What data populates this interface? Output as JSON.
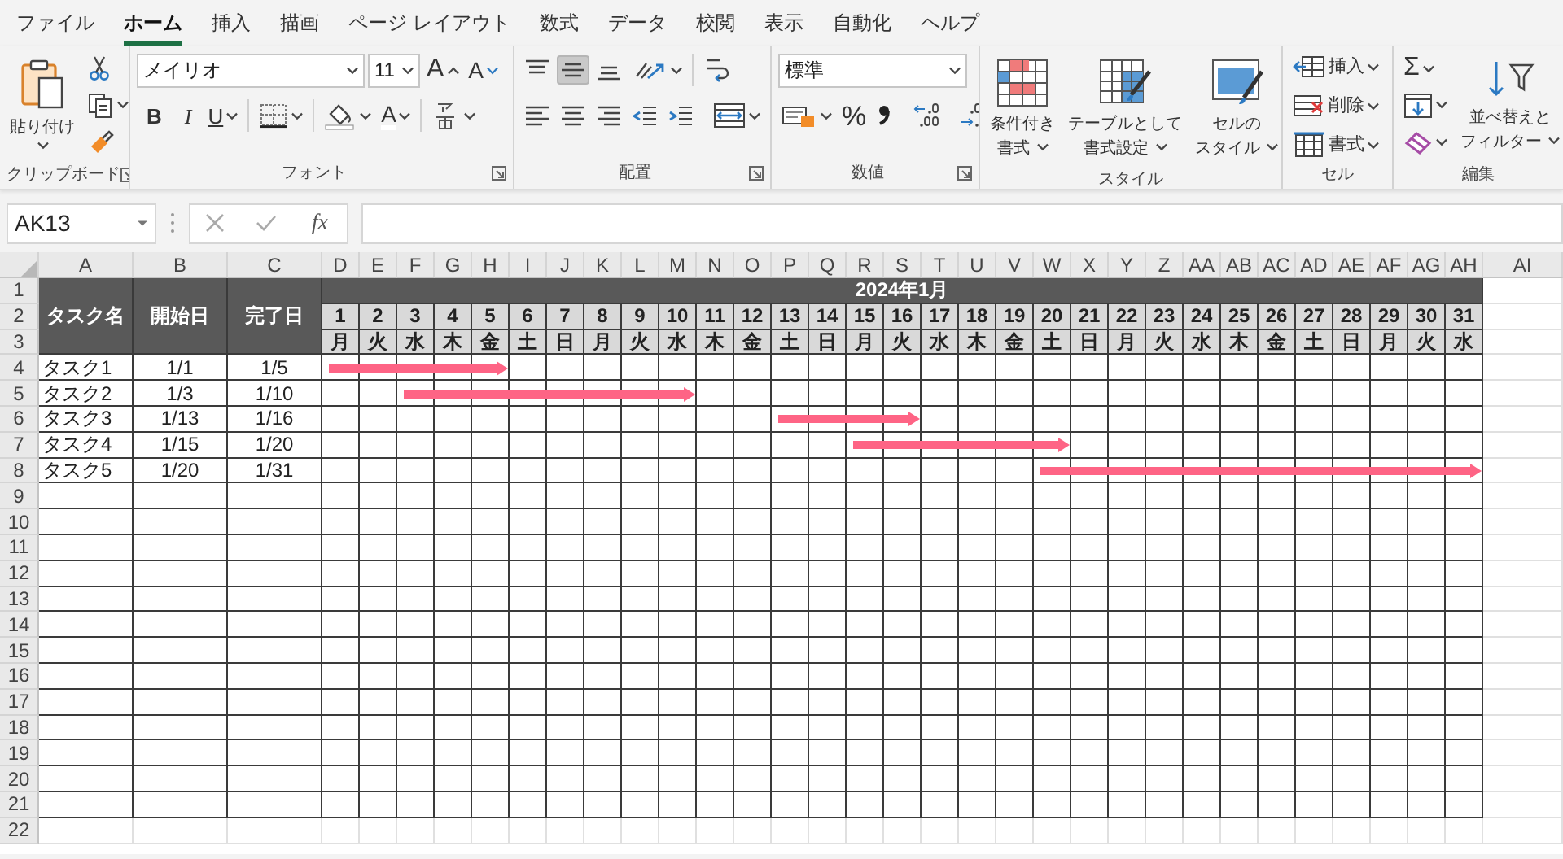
{
  "menu_tabs": [
    {
      "label": "ファイル",
      "selected": false
    },
    {
      "label": "ホーム",
      "selected": true
    },
    {
      "label": "挿入",
      "selected": false
    },
    {
      "label": "描画",
      "selected": false
    },
    {
      "label": "ページ レイアウト",
      "selected": false
    },
    {
      "label": "数式",
      "selected": false
    },
    {
      "label": "データ",
      "selected": false
    },
    {
      "label": "校閲",
      "selected": false
    },
    {
      "label": "表示",
      "selected": false
    },
    {
      "label": "自動化",
      "selected": false
    },
    {
      "label": "ヘルプ",
      "selected": false
    }
  ],
  "ribbon": {
    "clipboard": {
      "paste": "貼り付け",
      "label": "クリップボード"
    },
    "font": {
      "font_name": "メイリオ",
      "font_size": "11",
      "grow": "A",
      "shrink": "A",
      "bold": "B",
      "italic": "I",
      "underline": "U",
      "font_color": "A",
      "label": "フォント"
    },
    "alignment": {
      "vertical_align": [
        {
          "selected": false
        },
        {
          "selected": true
        },
        {
          "selected": false
        }
      ],
      "label": "配置"
    },
    "number": {
      "format": "標準",
      "percent": "%",
      "label": "数値"
    },
    "styles": {
      "buttons": [
        {
          "line1": "条件付き",
          "line2": "書式"
        },
        {
          "line1": "テーブルとして",
          "line2": "書式設定"
        },
        {
          "line1": "セルの",
          "line2": "スタイル"
        }
      ],
      "label": "スタイル"
    },
    "cells": {
      "buttons": [
        "挿入",
        "削除",
        "書式"
      ],
      "label": "セル"
    },
    "editing": {
      "autosum": "Σ",
      "sort_filter": {
        "line1": "並べ替えと",
        "line2": "フィルター"
      },
      "label": "編集"
    }
  },
  "formula_bar": {
    "name_box": "AK13",
    "function_label": "fx"
  },
  "sheet": {
    "columns": [
      "A",
      "B",
      "C",
      "D",
      "E",
      "F",
      "G",
      "H",
      "I",
      "J",
      "K",
      "L",
      "M",
      "N",
      "O",
      "P",
      "Q",
      "R",
      "S",
      "T",
      "U",
      "V",
      "W",
      "X",
      "Y",
      "Z",
      "AA",
      "AB",
      "AC",
      "AD",
      "AE",
      "AF",
      "AG",
      "AH",
      "AI"
    ],
    "rows": [
      "1",
      "2",
      "3",
      "4",
      "5",
      "6",
      "7",
      "8",
      "9",
      "10",
      "11",
      "12",
      "13",
      "14",
      "15",
      "16",
      "17",
      "18",
      "19",
      "20",
      "21",
      "22"
    ],
    "header": {
      "task": "タスク名",
      "start": "開始日",
      "end": "完了日"
    },
    "month": "2024年1月",
    "days": [
      {
        "day": "1",
        "weekday": "月"
      },
      {
        "day": "2",
        "weekday": "火"
      },
      {
        "day": "3",
        "weekday": "水"
      },
      {
        "day": "4",
        "weekday": "木"
      },
      {
        "day": "5",
        "weekday": "金"
      },
      {
        "day": "6",
        "weekday": "土"
      },
      {
        "day": "7",
        "weekday": "日"
      },
      {
        "day": "8",
        "weekday": "月"
      },
      {
        "day": "9",
        "weekday": "火"
      },
      {
        "day": "10",
        "weekday": "水"
      },
      {
        "day": "11",
        "weekday": "木"
      },
      {
        "day": "12",
        "weekday": "金"
      },
      {
        "day": "13",
        "weekday": "土"
      },
      {
        "day": "14",
        "weekday": "日"
      },
      {
        "day": "15",
        "weekday": "月"
      },
      {
        "day": "16",
        "weekday": "火"
      },
      {
        "day": "17",
        "weekday": "水"
      },
      {
        "day": "18",
        "weekday": "木"
      },
      {
        "day": "19",
        "weekday": "金"
      },
      {
        "day": "20",
        "weekday": "土"
      },
      {
        "day": "21",
        "weekday": "日"
      },
      {
        "day": "22",
        "weekday": "月"
      },
      {
        "day": "23",
        "weekday": "火"
      },
      {
        "day": "24",
        "weekday": "水"
      },
      {
        "day": "25",
        "weekday": "木"
      },
      {
        "day": "26",
        "weekday": "金"
      },
      {
        "day": "27",
        "weekday": "土"
      },
      {
        "day": "28",
        "weekday": "日"
      },
      {
        "day": "29",
        "weekday": "月"
      },
      {
        "day": "30",
        "weekday": "火"
      },
      {
        "day": "31",
        "weekday": "水"
      }
    ],
    "tasks": [
      {
        "name": "タスク1",
        "start": "1/1",
        "end": "1/5"
      },
      {
        "name": "タスク2",
        "start": "1/3",
        "end": "1/10"
      },
      {
        "name": "タスク3",
        "start": "1/13",
        "end": "1/16"
      },
      {
        "name": "タスク4",
        "start": "1/15",
        "end": "1/20"
      },
      {
        "name": "タスク5",
        "start": "1/20",
        "end": "1/31"
      }
    ]
  }
}
